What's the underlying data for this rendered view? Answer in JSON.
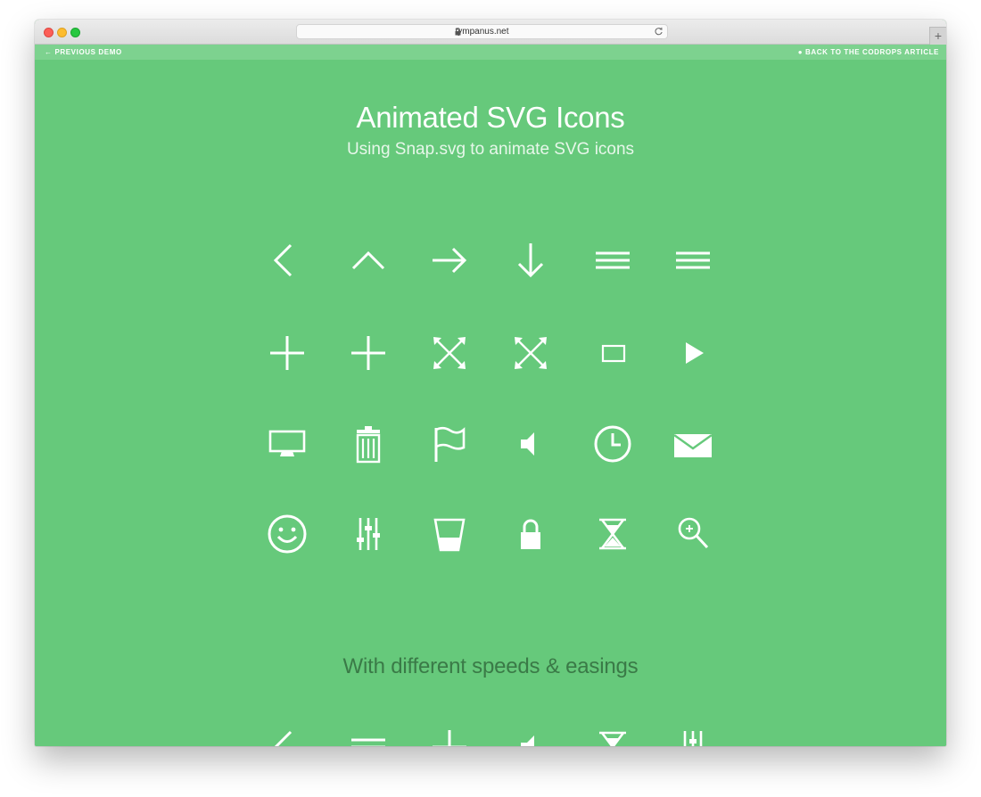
{
  "browser": {
    "url": "tympanus.net",
    "newtab_label": "+"
  },
  "nav": {
    "previous_demo": "PREVIOUS DEMO",
    "back_to_article": "BACK TO THE CODROPS ARTICLE"
  },
  "header": {
    "title": "Animated SVG Icons",
    "subtitle": "Using Snap.svg to animate SVG icons"
  },
  "section": {
    "heading": "With different speeds & easings"
  },
  "icon_grid": [
    [
      "left-arrow",
      "up-arrow",
      "right-arrow",
      "down-arrow",
      "hamburger-menu",
      "hamburger-menu"
    ],
    [
      "plus",
      "plus",
      "expand-arrows",
      "expand-arrows",
      "rectangle",
      "play"
    ],
    [
      "monitor",
      "trash",
      "flag",
      "speaker",
      "clock",
      "envelope"
    ],
    [
      "smiley",
      "equalizer-sliders",
      "glass",
      "lock",
      "hourglass",
      "zoom-in"
    ]
  ],
  "icon_row_bottom": [
    "left-arrow",
    "hamburger-menu",
    "plus",
    "speaker",
    "hourglass",
    "equalizer-sliders"
  ],
  "colors": {
    "background": "#66c97b",
    "nav_bar": "#7dd28f",
    "icon": "#ffffff",
    "section_heading": "#3a7a47"
  }
}
